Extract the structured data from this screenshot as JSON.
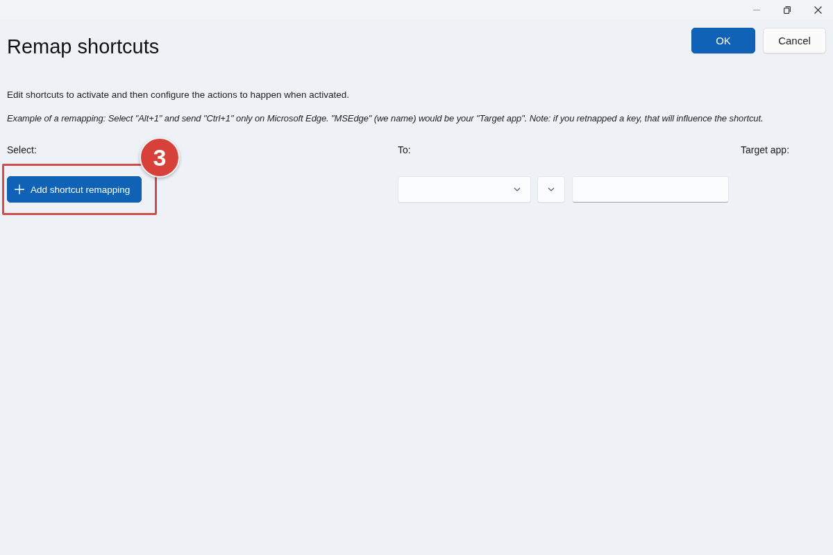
{
  "window": {
    "title": "Remap shortcuts"
  },
  "dialog_buttons": [
    {
      "label": "OK",
      "kind": "primary"
    },
    {
      "label": "Cancel",
      "kind": "secondary"
    }
  ],
  "description": "Edit shortcuts to activate and then configure the actions to happen when activated.",
  "example": "Example of a remapping: Select \"Alt+1\" and send \"Ctrl+1\" only on Microsoft Edge. \"MSEdge\" (we name) would be your \"Target app\". Note: if you retnapped a key, that will influence the shortcut.",
  "columns": [
    {
      "label": "Select:"
    },
    {
      "label": "To:"
    },
    {
      "label": "Target app:"
    }
  ],
  "add_button": {
    "label": "Add shortcut remapping"
  },
  "to_fields": [
    {
      "kind": "dropdown"
    },
    {
      "kind": "dropdown"
    },
    {
      "kind": "textbox"
    }
  ],
  "annotation": {
    "number": "3"
  }
}
